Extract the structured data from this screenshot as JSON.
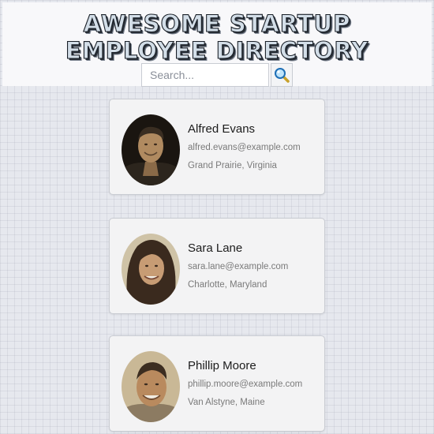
{
  "header": {
    "title_line1": "AWESOME STARTUP",
    "title_line2": "EMPLOYEE DIRECTORY"
  },
  "search": {
    "placeholder": "Search...",
    "value": "",
    "button_icon": "magnifier-icon"
  },
  "employees": [
    {
      "name": "Alfred Evans",
      "email": "alfred.evans@example.com",
      "location": "Grand Prairie, Virginia"
    },
    {
      "name": "Sara Lane",
      "email": "sara.lane@example.com",
      "location": "Charlotte, Maryland"
    },
    {
      "name": "Phillip Moore",
      "email": "phillip.moore@example.com",
      "location": "Van Alstyne, Maine"
    }
  ],
  "colors": {
    "background": "#e6e8ee",
    "card": "#f3f3f4",
    "title_fill": "#d3dee8",
    "title_outline": "#1a2028"
  }
}
